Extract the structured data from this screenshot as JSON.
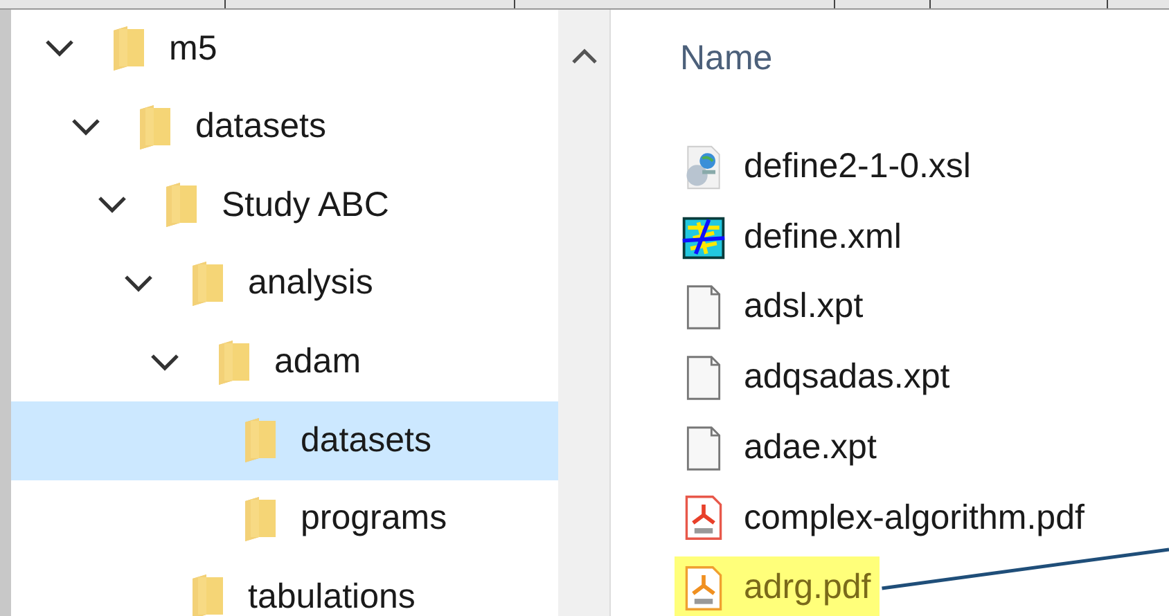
{
  "tree": [
    {
      "label": "m5",
      "expanded": true,
      "selected": false,
      "children": [
        {
          "label": "datasets",
          "expanded": true,
          "selected": false,
          "children": [
            {
              "label": "Study ABC",
              "expanded": true,
              "selected": false,
              "children": [
                {
                  "label": "analysis",
                  "expanded": true,
                  "selected": false,
                  "children": [
                    {
                      "label": "adam",
                      "expanded": true,
                      "selected": false,
                      "children": [
                        {
                          "label": "datasets",
                          "selected": true
                        },
                        {
                          "label": "programs",
                          "selected": false
                        }
                      ]
                    }
                  ]
                },
                {
                  "label": "tabulations",
                  "selected": false
                }
              ]
            }
          ]
        }
      ]
    }
  ],
  "files": {
    "column": "Name",
    "items": [
      {
        "name": "define2-1-0.xsl",
        "kind": "xsl",
        "highlighted": false
      },
      {
        "name": "define.xml",
        "kind": "xml",
        "highlighted": false
      },
      {
        "name": "adsl.xpt",
        "kind": "blank",
        "highlighted": false
      },
      {
        "name": "adqsadas.xpt",
        "kind": "blank",
        "highlighted": false
      },
      {
        "name": "adae.xpt",
        "kind": "blank",
        "highlighted": false
      },
      {
        "name": "complex-algorithm.pdf",
        "kind": "pdf",
        "highlighted": false
      },
      {
        "name": "adrg.pdf",
        "kind": "pdf",
        "highlighted": true
      }
    ]
  }
}
